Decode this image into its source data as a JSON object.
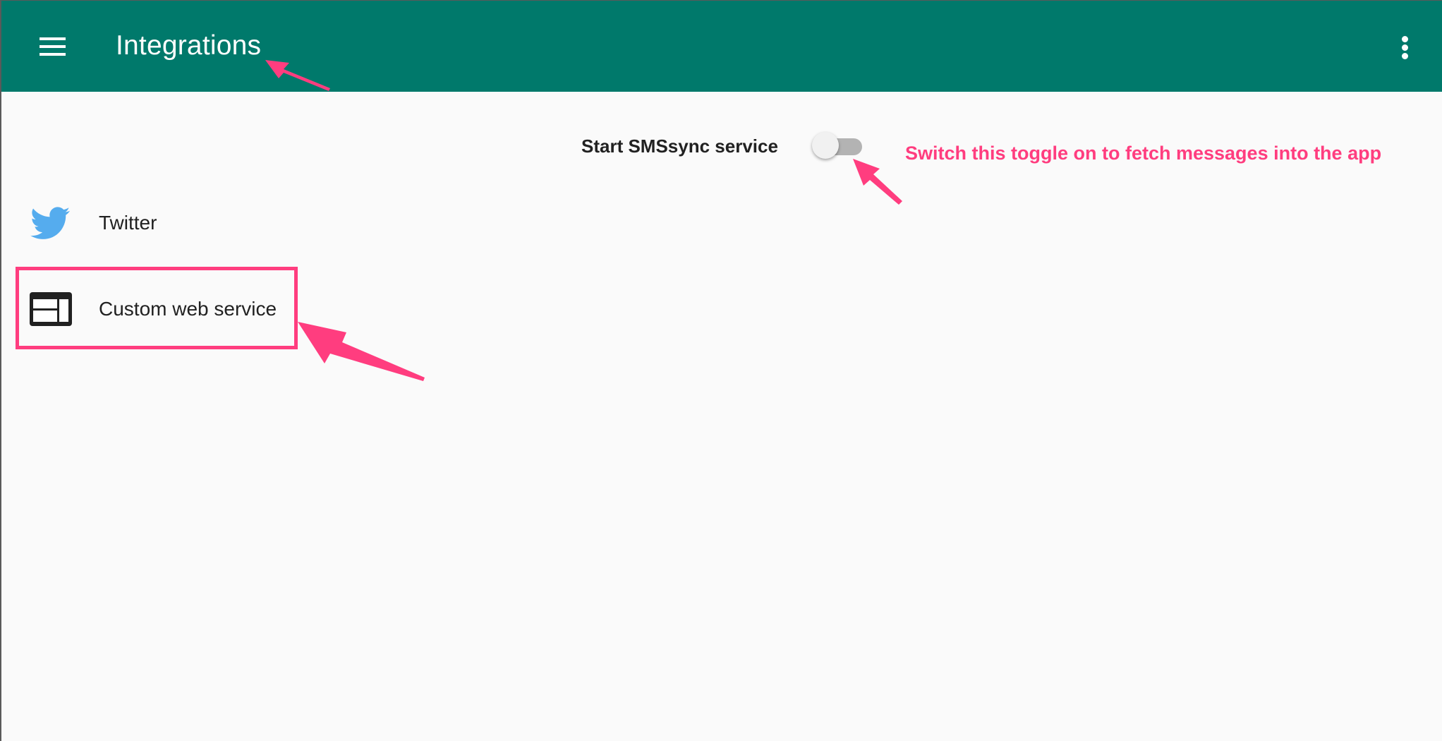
{
  "appbar": {
    "title": "Integrations",
    "menu_icon": "hamburger-menu-icon",
    "overflow_icon": "more-vert-icon",
    "color": "#00796b"
  },
  "service_toggle": {
    "label": "Start SMSsync service",
    "state": "off"
  },
  "integrations": [
    {
      "label": "Twitter",
      "icon": "twitter-bird-icon",
      "icon_color": "#55acee"
    },
    {
      "label": "Custom web service",
      "icon": "web-layout-icon",
      "icon_color": "#212121"
    }
  ],
  "annotation": {
    "note": "Switch this toggle on to fetch messages into the app",
    "color": "#ff3d7f"
  }
}
